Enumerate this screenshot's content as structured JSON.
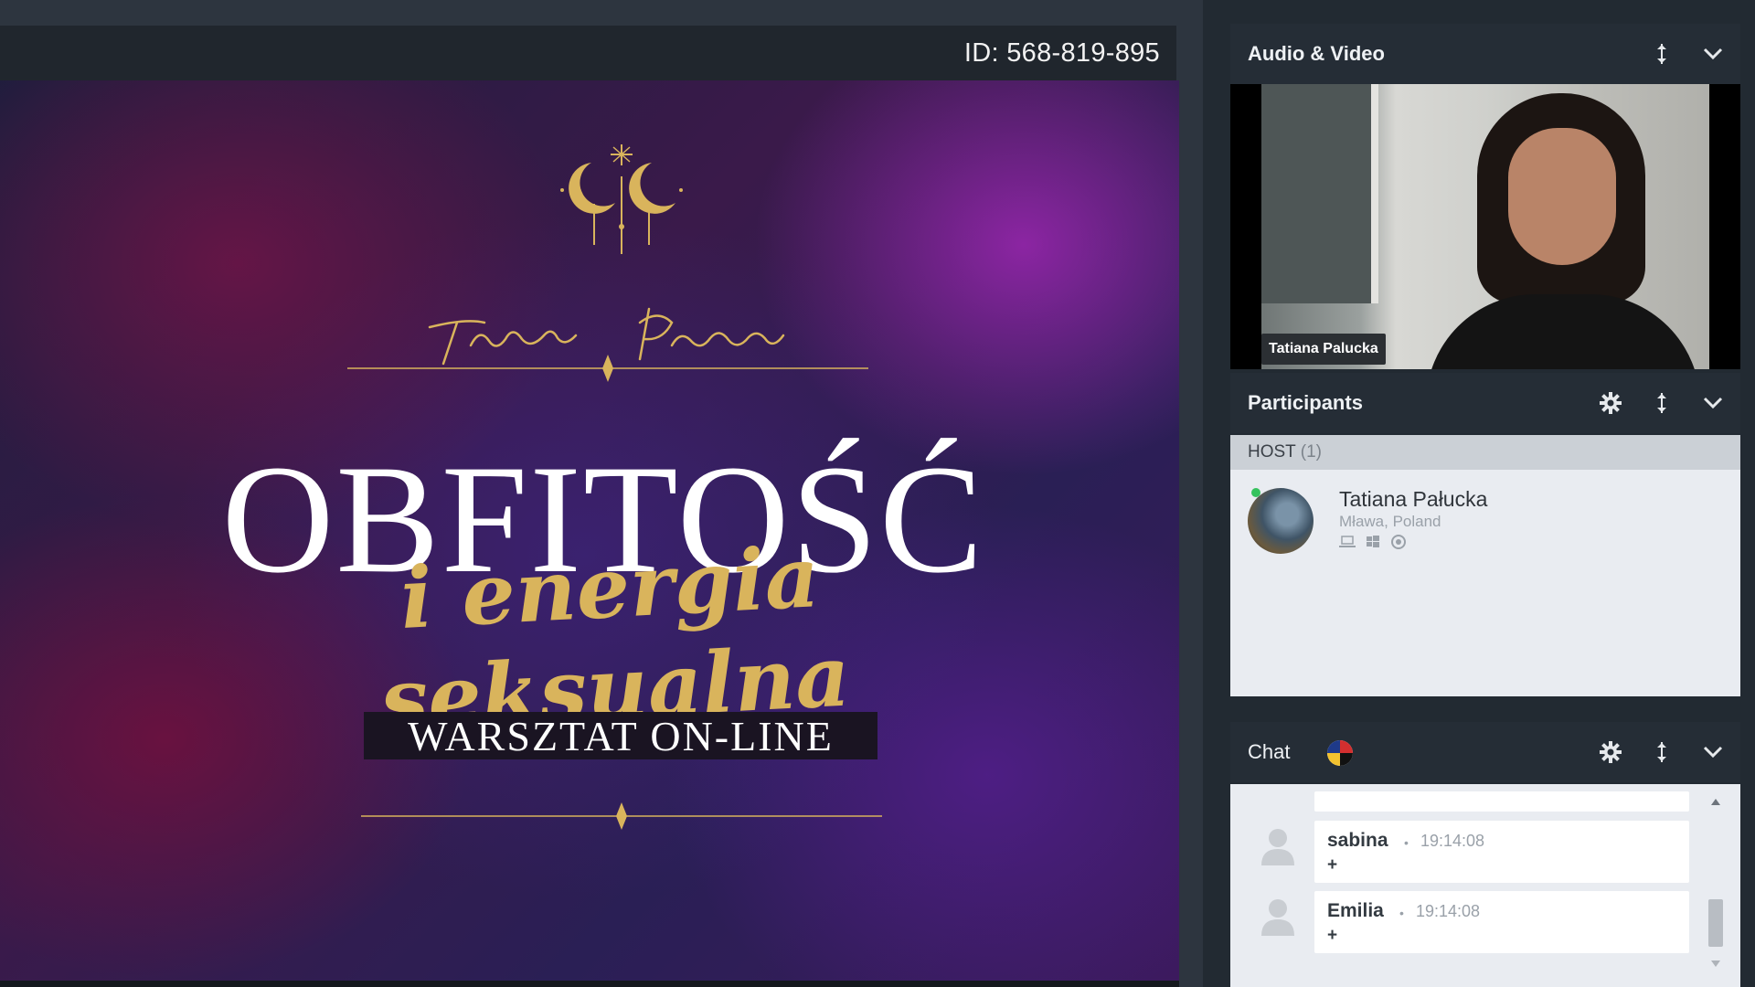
{
  "meeting": {
    "id_label": "ID: 568-819-895"
  },
  "slide": {
    "title": "OBFITOŚĆ",
    "subtitle": "i energia seksualna",
    "badge": "WARSZTAT ON-LINE",
    "logo_icon": "crescent-moons-logo",
    "signature_icon": "handwritten-signature",
    "colors": {
      "gold": "#d9b45c"
    }
  },
  "audio_video": {
    "title": "Audio & Video",
    "video_name": "Tatiana Palucka"
  },
  "participants": {
    "title": "Participants",
    "host_label": "HOST",
    "host_count": "(1)",
    "items": [
      {
        "name": "Tatiana Pałucka",
        "location": "Mława, Poland",
        "online": true,
        "devices": [
          "laptop-icon",
          "windows-icon",
          "chrome-icon"
        ]
      }
    ]
  },
  "chat": {
    "title": "Chat",
    "flag_icon": "language-flag-icon",
    "messages": [
      {
        "author": "sabina",
        "time": "19:14:08",
        "text": "+"
      },
      {
        "author": "Emilia",
        "time": "19:14:08",
        "text": "+"
      }
    ]
  },
  "icons": {
    "settings": "gear-icon",
    "pin": "pin-icon",
    "collapse": "chevron-down-icon"
  }
}
